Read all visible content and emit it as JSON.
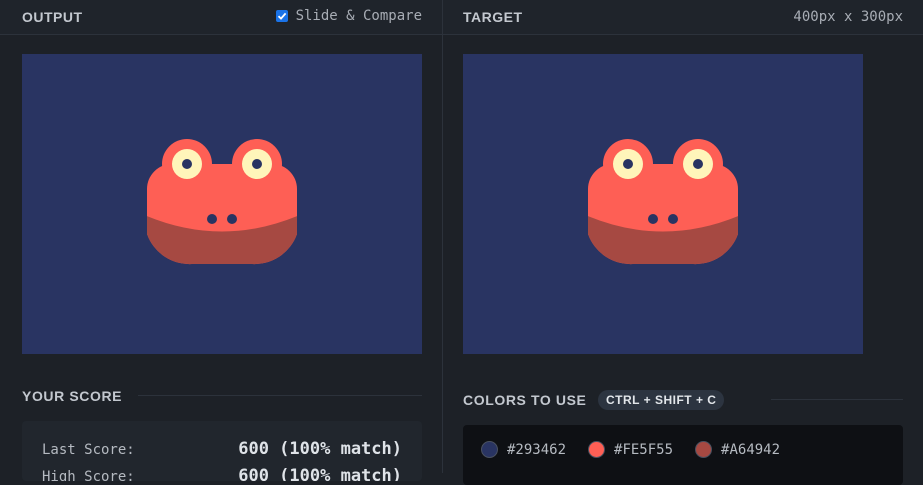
{
  "output": {
    "title": "OUTPUT",
    "slide_compare": {
      "label": "Slide & Compare",
      "checked": true
    }
  },
  "target": {
    "title": "TARGET",
    "dimensions": "400px x 300px"
  },
  "score": {
    "title": "YOUR SCORE",
    "last_label": "Last Score:",
    "last_value": "600 (100% match)",
    "high_label": "High Score:",
    "high_value": "600 (100% match)"
  },
  "colors": {
    "title": "COLORS TO USE",
    "shortcut": "CTRL + SHIFT + C",
    "swatches": [
      {
        "hex": "#293462",
        "label": "#293462"
      },
      {
        "hex": "#FE5F55",
        "label": "#FE5F55"
      },
      {
        "hex": "#A64942",
        "label": "#A64942"
      }
    ]
  },
  "theme": {
    "background": "#293462",
    "frog_body": "#FE5F55",
    "frog_lower": "#A64942",
    "eye_white": "#FFF5BA",
    "pupil": "#293462"
  }
}
